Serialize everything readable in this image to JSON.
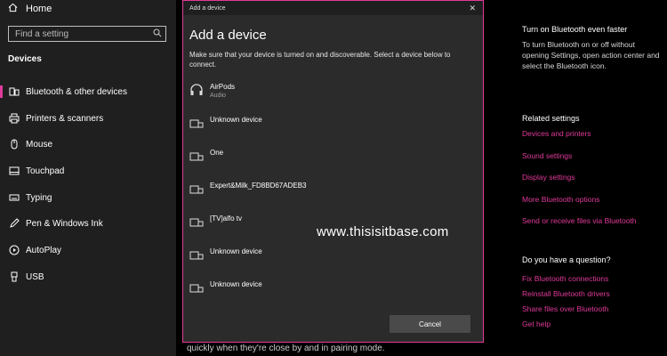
{
  "sidebar": {
    "home_label": "Home",
    "search_placeholder": "Find a setting",
    "section_title": "Devices",
    "items": [
      {
        "label": "Bluetooth & other devices",
        "icon": "bluetooth-devices-icon"
      },
      {
        "label": "Printers & scanners",
        "icon": "printer-icon"
      },
      {
        "label": "Mouse",
        "icon": "mouse-icon"
      },
      {
        "label": "Touchpad",
        "icon": "touchpad-icon"
      },
      {
        "label": "Typing",
        "icon": "keyboard-icon"
      },
      {
        "label": "Pen & Windows Ink",
        "icon": "pen-icon"
      },
      {
        "label": "AutoPlay",
        "icon": "autoplay-icon"
      },
      {
        "label": "USB",
        "icon": "usb-icon"
      }
    ]
  },
  "dialog": {
    "window_title": "Add a device",
    "close_glyph": "✕",
    "heading": "Add a device",
    "description": "Make sure that your device is turned on and discoverable. Select a device below to connect.",
    "devices": [
      {
        "name": "AirPods",
        "sub": "Audio",
        "icon": "headphones-icon"
      },
      {
        "name": "Unknown device",
        "sub": "",
        "icon": "display-device-icon"
      },
      {
        "name": "One",
        "sub": "",
        "icon": "display-device-icon"
      },
      {
        "name": "Expert&Milk_FD8BD67ADEB3",
        "sub": "",
        "icon": "display-device-icon"
      },
      {
        "name": "[TV]alfo tv",
        "sub": "",
        "icon": "display-device-icon"
      },
      {
        "name": "Unknown device",
        "sub": "",
        "icon": "display-device-icon"
      },
      {
        "name": "Unknown device",
        "sub": "",
        "icon": "display-device-icon"
      }
    ],
    "cancel_label": "Cancel"
  },
  "main": {
    "bottom_text": "quickly when they're close by and in pairing mode."
  },
  "watermark": "www.thisisitbase.com",
  "right_panel": {
    "tip_heading": "Turn on Bluetooth even faster",
    "tip_text": "To turn Bluetooth on or off without opening Settings, open action center and select the Bluetooth icon.",
    "related_heading": "Related settings",
    "related_links": [
      "Devices and printers",
      "Sound settings",
      "Display settings",
      "More Bluetooth options",
      "Send or receive files via Bluetooth"
    ],
    "question_heading": "Do you have a question?",
    "question_links": [
      "Fix Bluetooth connections",
      "Reinstall Bluetooth drivers",
      "Share files over Bluetooth",
      "Get help"
    ]
  },
  "colors": {
    "accent": "#e03a9a",
    "sidebar_bg": "#1f1f1f",
    "dialog_bg": "#2b2b2b"
  }
}
